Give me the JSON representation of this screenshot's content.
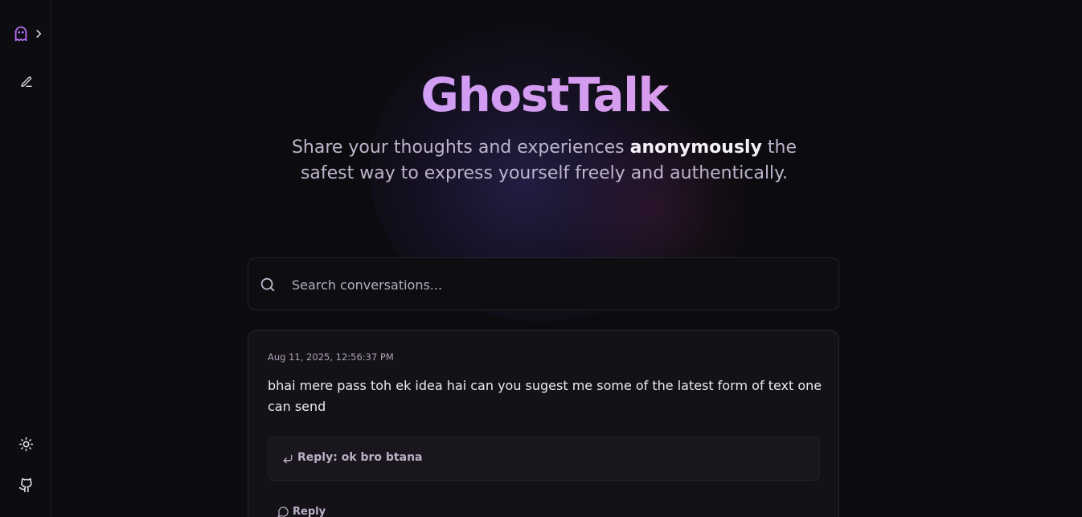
{
  "sidebar": {
    "logo_icon": "ghost-icon",
    "expand_icon": "chevron-right-icon",
    "new_icon": "pencil-icon",
    "theme_icon": "sun-icon",
    "github_icon": "github-icon"
  },
  "hero": {
    "title": "GhostTalk",
    "subtitle_before": "Share your thoughts and experiences ",
    "subtitle_emphasis": "anonymously",
    "subtitle_after": " the safest way to express yourself freely and authentically."
  },
  "search": {
    "placeholder": "Search conversations..."
  },
  "posts": [
    {
      "timestamp": "Aug 11, 2025, 12:56:37 PM",
      "message": "bhai mere pass toh ek idea hai can you sugest me some of the latest form of text one can send",
      "reply": "Reply: ok bro btana",
      "reply_button": "Reply"
    }
  ],
  "colors": {
    "accent": "#c9a6ff",
    "background": "#0c0b0f",
    "card": "#141217"
  }
}
